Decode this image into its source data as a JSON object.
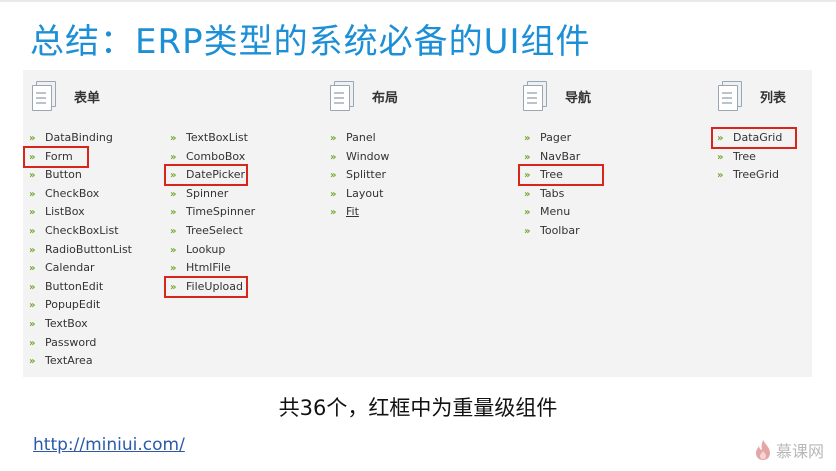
{
  "title": "总结：ERP类型的系统必备的UI组件",
  "groups": [
    {
      "title": "表单"
    },
    {
      "title": "布局"
    },
    {
      "title": "导航"
    },
    {
      "title": "列表"
    }
  ],
  "form_col1": [
    "DataBinding",
    "Form",
    "Button",
    "CheckBox",
    "ListBox",
    "CheckBoxList",
    "RadioButtonList",
    "Calendar",
    "ButtonEdit",
    "PopupEdit",
    "TextBox",
    "Password",
    "TextArea"
  ],
  "form_col2": [
    "TextBoxList",
    "ComboBox",
    "DatePicker",
    "Spinner",
    "TimeSpinner",
    "TreeSelect",
    "Lookup",
    "HtmlFile",
    "FileUpload"
  ],
  "layout_items": [
    "Panel",
    "Window",
    "Splitter",
    "Layout",
    "Fit"
  ],
  "nav_items": [
    "Pager",
    "NavBar",
    "Tree",
    "Tabs",
    "Menu",
    "Toolbar"
  ],
  "list_items": [
    "DataGrid",
    "Tree",
    "TreeGrid"
  ],
  "highlighted": [
    "Form",
    "DatePicker",
    "FileUpload",
    "Tree",
    "DataGrid"
  ],
  "chevron": "»",
  "footer": "共36个，红框中为重量级组件",
  "link": "http://miniui.com/",
  "logo_text": "慕课网",
  "colors": {
    "title": "#1d8fd6",
    "highlight": "#d9261c",
    "chevron": "#6fa72a",
    "link": "#2a5aa8"
  },
  "icons": [
    "document-icon",
    "flame-logo-icon"
  ]
}
